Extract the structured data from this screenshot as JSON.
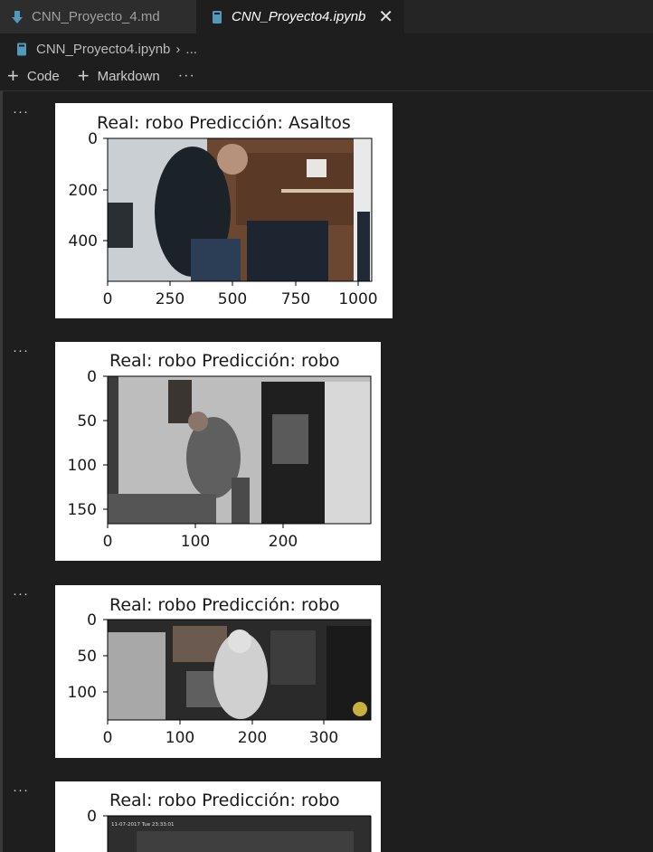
{
  "tabs": [
    {
      "label": "CNN_Proyecto_4.md",
      "icon": "markdown-arrow-icon"
    },
    {
      "label": "CNN_Proyecto4.ipynb",
      "icon": "notebook-icon",
      "active": true
    }
  ],
  "breadcrumb": {
    "file": "CNN_Proyecto4.ipynb",
    "more": "..."
  },
  "toolbar": {
    "code_label": "Code",
    "markdown_label": "Markdown",
    "more": "···"
  },
  "outputs": [
    {
      "more": "···",
      "title": "Real: robo  Predicción: Asaltos",
      "image_width": 1050,
      "image_height": 560,
      "xticks": [
        "0",
        "250",
        "500",
        "750",
        "1000"
      ],
      "yticks": [
        "0",
        "200",
        "400"
      ],
      "scene": "office"
    },
    {
      "more": "···",
      "title": "Real: robo  Predicción: robo",
      "image_width": 295,
      "image_height": 165,
      "xticks": [
        "0",
        "100",
        "200"
      ],
      "yticks": [
        "0",
        "50",
        "100",
        "150"
      ],
      "scene": "home-grayscale"
    },
    {
      "more": "···",
      "title": "Real: robo  Predicción: robo",
      "image_width": 365,
      "image_height": 140,
      "xticks": [
        "0",
        "100",
        "200",
        "300"
      ],
      "yticks": [
        "0",
        "50",
        "100"
      ],
      "scene": "store-night"
    },
    {
      "more": "···",
      "title": "Real: robo  Predicción: robo",
      "xticks": [],
      "yticks": [
        "0"
      ],
      "scene": "cctv-partial",
      "timestamp": "11-07-2017 Tue 23:33:01"
    }
  ],
  "colors": {
    "editor_bg": "#1e1e1e",
    "tabbar_bg": "#252526",
    "notebook_icon": "#519aba",
    "markdown_icon": "#519aba",
    "plot_bg": "#ffffff"
  }
}
